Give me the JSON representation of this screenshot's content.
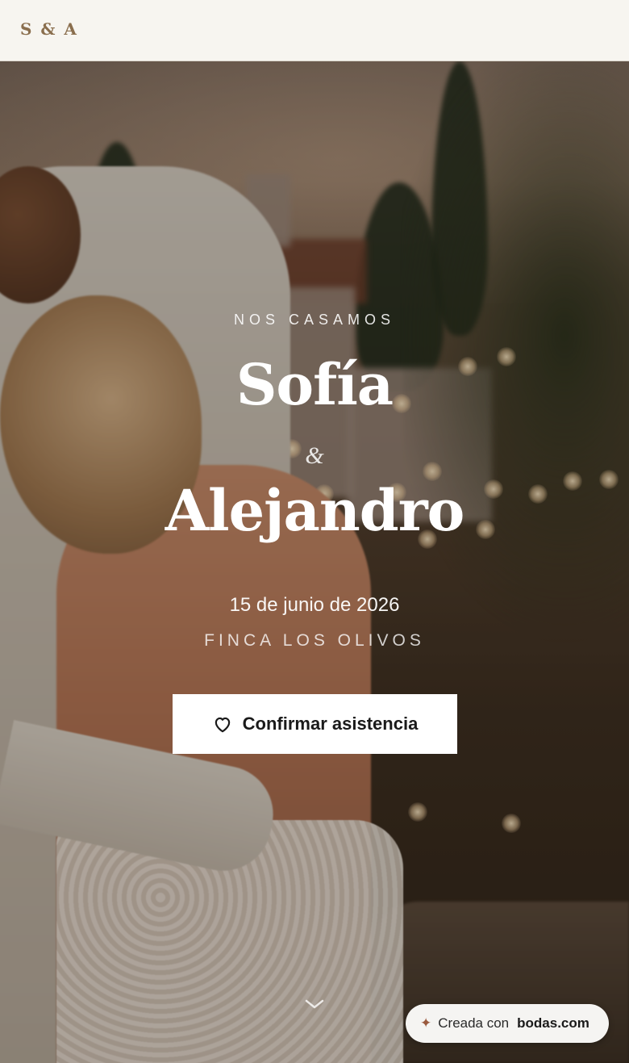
{
  "header": {
    "monogram": "S & A"
  },
  "hero": {
    "eyebrow": "NOS CASAMOS",
    "partner1": "Sofía",
    "ampersand": "&",
    "partner2": "Alejandro",
    "date": "15 de junio de 2026",
    "venue": "FINCA LOS OLIVOS",
    "rsvp": {
      "label": "Confirmar asistencia",
      "icon": "heart-icon"
    },
    "scroll_icon": "chevron-down-icon"
  },
  "badge": {
    "icon": "sparkle-icon",
    "text": "Creada con",
    "brand": "bodas.com"
  },
  "colors": {
    "header_bg": "#f7f5f0",
    "monogram": "#8a6e4d",
    "button_bg": "#ffffff",
    "button_text": "#1a1a1a",
    "sparkle": "#9a5a3e"
  }
}
